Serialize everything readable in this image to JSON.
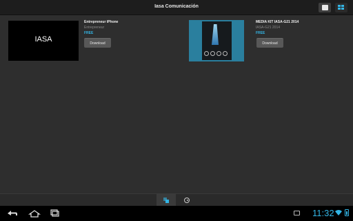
{
  "app": {
    "title": "Iasa Comunicación"
  },
  "view_toggle": {
    "single_icon": "single-view-icon",
    "grid_icon": "grid-view-icon"
  },
  "items": [
    {
      "thumb_text": "IASA",
      "name": "Entrepreneur iPhone",
      "subtitle": "Entrepreneur",
      "price": "FREE",
      "button": "Download"
    },
    {
      "name": "MEDIA KIT IASA-G21 2014",
      "subtitle": "IASA-G21 2014",
      "price": "FREE",
      "button": "Download"
    }
  ],
  "tabs": [
    {
      "icon": "library-icon",
      "selected": true
    },
    {
      "icon": "store-icon",
      "selected": false
    }
  ],
  "status_bar": {
    "time": "11:32",
    "accent": "#33b5e5"
  },
  "colors": {
    "accent": "#33b5e5",
    "background": "#2e2e2e",
    "button": "#585858"
  }
}
